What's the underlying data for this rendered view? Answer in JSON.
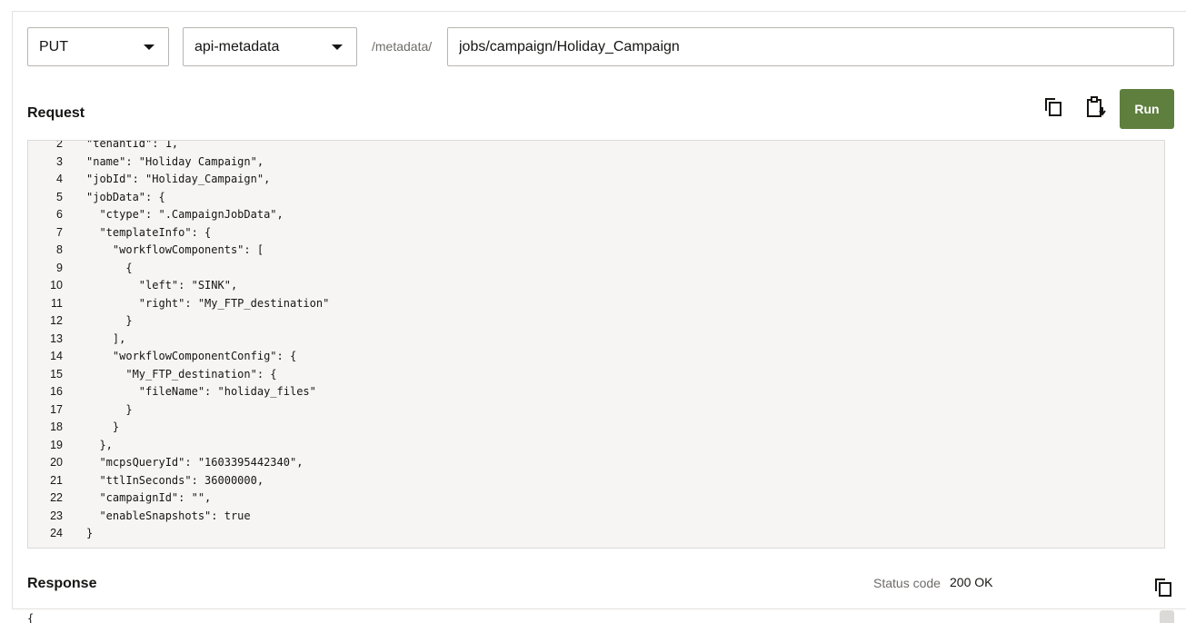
{
  "toolbar": {
    "method": "PUT",
    "service": "api-metadata",
    "path_prefix": "/metadata/",
    "path_value": "jobs/campaign/Holiday_Campaign",
    "run_label": "Run"
  },
  "request": {
    "title": "Request",
    "first_visible_line": 2,
    "lines": [
      "\"tenantId\": 1,",
      "\"name\": \"Holiday Campaign\",",
      "\"jobId\": \"Holiday_Campaign\",",
      "\"jobData\": {",
      "  \"ctype\": \".CampaignJobData\",",
      "  \"templateInfo\": {",
      "    \"workflowComponents\": [",
      "      {",
      "        \"left\": \"SINK\",",
      "        \"right\": \"My_FTP_destination\"",
      "      }",
      "    ],",
      "    \"workflowComponentConfig\": {",
      "      \"My_FTP_destination\": {",
      "        \"fileName\": \"holiday_files\"",
      "      }",
      "    }",
      "  },",
      "  \"mcpsQueryId\": \"1603395442340\",",
      "  \"ttlInSeconds\": 36000000,",
      "  \"campaignId\": \"\",",
      "  \"enableSnapshots\": true",
      "}"
    ]
  },
  "response": {
    "title": "Response",
    "status_label": "Status code",
    "status_value": "200 OK",
    "body_start": "{"
  },
  "colors": {
    "run_button": "#5e7f3e",
    "editor_bg": "#f6f5f4"
  },
  "icons": {
    "copy": "copy-icon",
    "paste": "paste-icon"
  }
}
